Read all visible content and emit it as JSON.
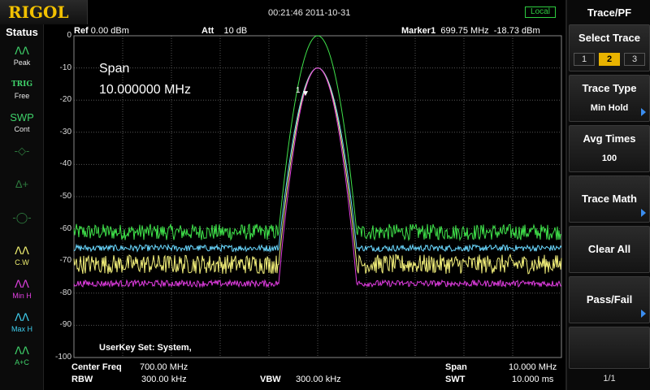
{
  "brand": {
    "logo": "RIGOL"
  },
  "topbar": {
    "datetime": "00:21:46 2011-10-31",
    "local": "Local"
  },
  "status": {
    "title": "Status",
    "items": [
      {
        "icon": "peak-icon",
        "glyph": "ᐱᐱ",
        "label": "Peak",
        "color": "#3fd16a"
      },
      {
        "icon": "trig-icon",
        "glyph": "TRIG",
        "label": "Free",
        "color": "#3fd16a"
      },
      {
        "icon": "sweep-icon",
        "glyph": "SWP",
        "label": "Cont",
        "color": "#3fd16a"
      },
      {
        "icon": "demod-icon",
        "glyph": "-◇-",
        "label": "",
        "color": "#2e7a3e"
      },
      {
        "icon": "delta-icon",
        "glyph": "Δ+",
        "label": "",
        "color": "#2e7a3e"
      },
      {
        "icon": "filter-icon",
        "glyph": "-◯-",
        "label": "",
        "color": "#2e7a3e"
      },
      {
        "icon": "clear-write-icon",
        "glyph": "ᐱᐱ",
        "label": "C.W",
        "color": "#f0f070"
      },
      {
        "icon": "min-hold-icon",
        "glyph": "ᐱᐱ",
        "label": "Min H",
        "color": "#e040e0"
      },
      {
        "icon": "max-hold-icon",
        "glyph": "ᐱᐱ",
        "label": "Max H",
        "color": "#40d0f0"
      },
      {
        "icon": "trace-math-icon",
        "glyph": "ᐱᐱ",
        "label": "A+C",
        "color": "#3fd16a"
      }
    ]
  },
  "header": {
    "ref_label": "Ref",
    "ref_value": "0.00 dBm",
    "att_label": "Att",
    "att_value": "10 dB",
    "marker_label": "Marker1",
    "marker_freq": "699.75 MHz",
    "marker_level": "-18.73 dBm"
  },
  "y_ticks": [
    "0",
    "-10",
    "-20",
    "-30",
    "-40",
    "-50",
    "-60",
    "-70",
    "-80",
    "-90",
    "-100"
  ],
  "annotation": {
    "span_label": "Span",
    "span_value": "10.000000 MHz",
    "userkey": "UserKey Set:    System,"
  },
  "marker": {
    "label": "1"
  },
  "footer": {
    "center_label": "Center Freq",
    "center_value": "700.00 MHz",
    "rbw_label": "RBW",
    "rbw_value": "300.00 kHz",
    "vbw_label": "VBW",
    "vbw_value": "300.00 kHz",
    "span_label": "Span",
    "span_value": "10.000 MHz",
    "swt_label": "SWT",
    "swt_value": "10.000 ms"
  },
  "menu": {
    "title": "Trace/PF",
    "select_trace": {
      "label": "Select Trace",
      "options": [
        "1",
        "2",
        "3"
      ],
      "selected": "2"
    },
    "trace_type": {
      "label": "Trace Type",
      "value": "Min Hold"
    },
    "avg_times": {
      "label": "Avg Times",
      "value": "100"
    },
    "trace_math": {
      "label": "Trace Math"
    },
    "clear_all": {
      "label": "Clear All"
    },
    "pass_fail": {
      "label": "Pass/Fail"
    },
    "page": "1/1"
  },
  "colors": {
    "grid": "#555555",
    "trace_green": "#3fe14a",
    "trace_cyan": "#6ad8ff",
    "trace_yellow": "#f3f07a",
    "trace_magenta": "#e03ce0",
    "trace_blue": "#a8a8ff",
    "accent": "#e8b300"
  },
  "chart_data": {
    "type": "line",
    "x_center_mhz": 700.0,
    "x_span_mhz": 10.0,
    "ylim": [
      -100,
      0
    ],
    "y_unit": "dBm",
    "marker": {
      "x_mhz": 699.75,
      "y_dbm": -18.73
    },
    "series": [
      {
        "color": "#3fe14a",
        "noise_floor": -61,
        "noise_amp": 2.5,
        "peak": 0
      },
      {
        "color": "#6ad8ff",
        "noise_floor": -66,
        "noise_amp": 1.0,
        "peak": -10
      },
      {
        "color": "#f3f07a",
        "noise_floor": -71,
        "noise_amp": 3.0,
        "peak": -10
      },
      {
        "color": "#e03ce0",
        "noise_floor": -77,
        "noise_amp": 1.0,
        "peak": -10
      }
    ]
  }
}
